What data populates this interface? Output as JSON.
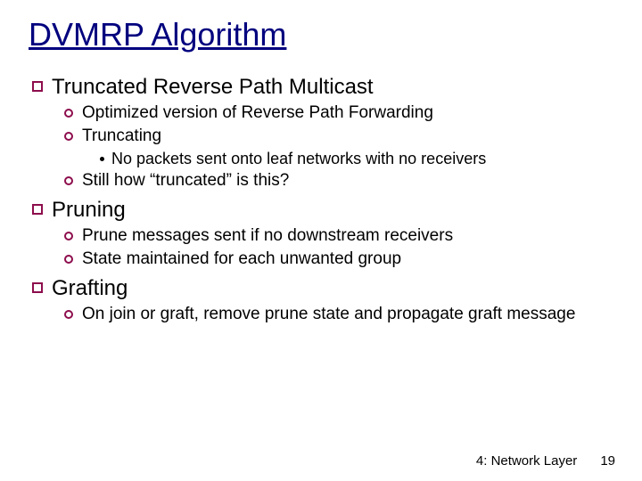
{
  "title": "DVMRP Algorithm",
  "sections": [
    {
      "heading": "Truncated Reverse Path Multicast",
      "items": [
        {
          "text": "Optimized version of Reverse Path Forwarding",
          "sub": []
        },
        {
          "text": "Truncating",
          "sub": [
            "No packets sent onto leaf networks with no receivers"
          ]
        },
        {
          "text": "Still how “truncated” is this?",
          "sub": []
        }
      ]
    },
    {
      "heading": "Pruning",
      "items": [
        {
          "text": "Prune messages sent if no downstream receivers",
          "sub": []
        },
        {
          "text": "State maintained for each unwanted group",
          "sub": []
        }
      ]
    },
    {
      "heading": "Grafting",
      "items": [
        {
          "text": "On join or graft, remove prune state and propagate graft message",
          "sub": []
        }
      ]
    }
  ],
  "footer": {
    "chapter": "4: Network Layer",
    "page": "19"
  }
}
